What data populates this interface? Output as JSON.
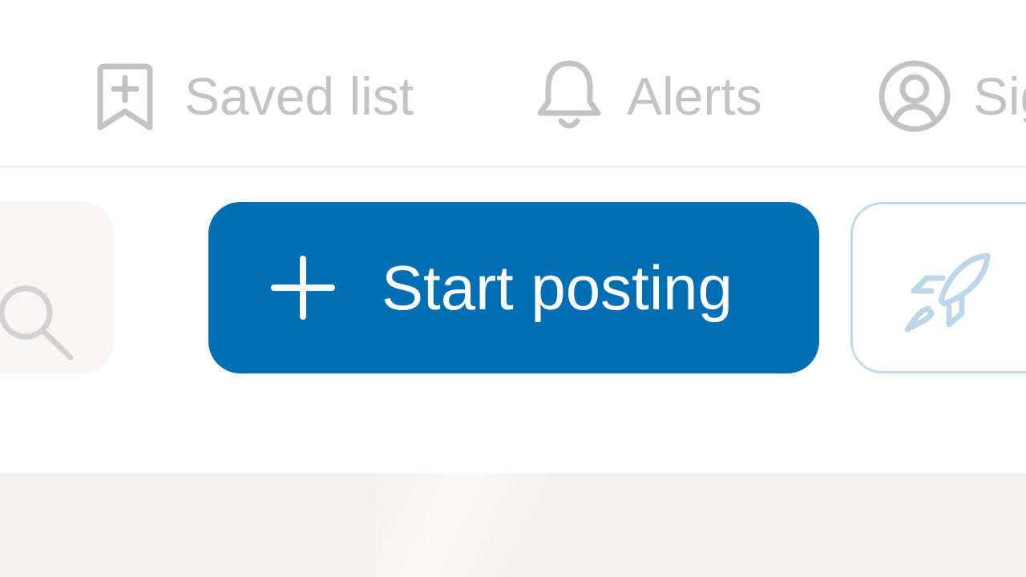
{
  "nav": {
    "saved": {
      "label": "Saved list",
      "icon": "bookmark-plus-icon"
    },
    "alerts": {
      "label": "Alerts",
      "icon": "bell-icon"
    },
    "signin": {
      "label": "Sig",
      "icon": "user-circle-icon"
    }
  },
  "actions": {
    "search": {
      "icon": "search-icon"
    },
    "start_posting": {
      "label": "Start posting",
      "icon": "plus-icon"
    },
    "boost": {
      "icon": "rocket-icon"
    }
  },
  "colors": {
    "primary": "#006fb4",
    "nav_text": "#c3c3c3",
    "content_background": "#f5f2ed",
    "boost_outline": "#c2d9ea"
  }
}
